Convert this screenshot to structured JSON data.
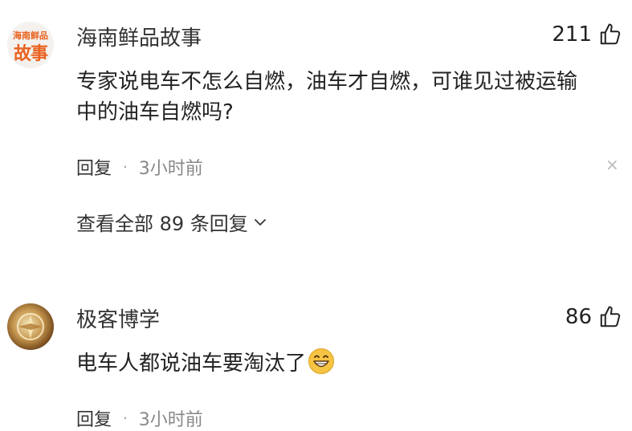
{
  "comments": [
    {
      "avatar": {
        "line1": "海南鲜品",
        "line2": "故事"
      },
      "username": "海南鲜品故事",
      "likes": "211",
      "text_line1": "专家说电车不怎么自燃，油车才自燃，可谁见过被运输",
      "text_line2": "中的油车自燃吗?",
      "reply_label": "回复",
      "separator": "·",
      "time": "3小时前",
      "close_symbol": "×",
      "view_all_replies": "查看全部 89 条回复"
    },
    {
      "username": "极客博学",
      "likes": "86",
      "text": "电车人都说油车要淘汰了",
      "emoji": "grinning-face-icon",
      "reply_label": "回复",
      "separator": "·",
      "time": "3小时前"
    }
  ],
  "colors": {
    "avatar_brand": "#e8621f",
    "emoji": "#f6c343"
  }
}
